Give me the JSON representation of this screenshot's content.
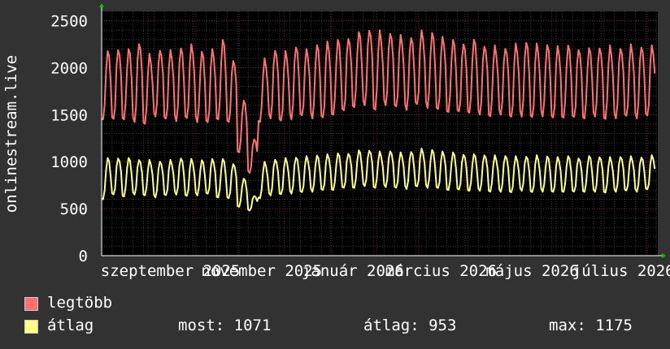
{
  "chart_data": {
    "type": "line",
    "ylabel": "onlinestream.live",
    "ylim": [
      0,
      2600
    ],
    "yticks": [
      0,
      500,
      1000,
      1500,
      2000,
      2500
    ],
    "x_tick_labels": [
      "szeptember 2025",
      "november 2025",
      "január 2026",
      "március 2026",
      "május 2026",
      "július 2026"
    ],
    "x_range": [
      "2025-08-01",
      "2026-08-08"
    ],
    "grid": true,
    "series": [
      {
        "name": "legtöbb",
        "color": "#ff7070",
        "weekly_high": [
          2180,
          2220,
          2200,
          2280,
          2150,
          2200,
          2190,
          2220,
          2250,
          2180,
          2200,
          2300,
          2100,
          1650,
          1250,
          2100,
          2200,
          2180,
          2230,
          2200,
          2250,
          2280,
          2300,
          2340,
          2380,
          2420,
          2400,
          2380,
          2350,
          2330,
          2400,
          2380,
          2330,
          2300,
          2280,
          2300,
          2250,
          2240,
          2220,
          2260,
          2280,
          2260,
          2250,
          2230,
          2240,
          2220,
          2210,
          2230,
          2240,
          2220,
          2250,
          2230,
          2240
        ],
        "weekly_low": [
          1450,
          1430,
          1450,
          1420,
          1400,
          1480,
          1450,
          1430,
          1450,
          1420,
          1400,
          1450,
          1400,
          1100,
          880,
          1420,
          1460,
          1430,
          1450,
          1480,
          1460,
          1450,
          1500,
          1520,
          1580,
          1600,
          1550,
          1600,
          1580,
          1550,
          1600,
          1570,
          1540,
          1530,
          1510,
          1520,
          1500,
          1480,
          1500,
          1470,
          1480,
          1460,
          1480,
          1450,
          1470,
          1450,
          1460,
          1480,
          1450,
          1460,
          1480,
          1460,
          1480
        ]
      },
      {
        "name": "átlag",
        "color": "#ffff80",
        "weekly_high": [
          1040,
          1050,
          1040,
          1030,
          1020,
          1010,
          1020,
          1040,
          1030,
          1020,
          1030,
          1030,
          990,
          820,
          640,
          1000,
          1030,
          1040,
          1050,
          1060,
          1070,
          1080,
          1090,
          1100,
          1120,
          1130,
          1110,
          1120,
          1100,
          1110,
          1140,
          1130,
          1110,
          1100,
          1090,
          1080,
          1080,
          1070,
          1070,
          1060,
          1060,
          1070,
          1060,
          1050,
          1060,
          1050,
          1060,
          1060,
          1050,
          1060,
          1060,
          1050,
          1070
        ],
        "weekly_low": [
          600,
          640,
          630,
          650,
          640,
          620,
          640,
          650,
          630,
          640,
          650,
          620,
          600,
          520,
          480,
          610,
          640,
          650,
          660,
          670,
          680,
          690,
          700,
          710,
          720,
          740,
          720,
          730,
          720,
          710,
          730,
          720,
          710,
          700,
          690,
          690,
          690,
          680,
          680,
          670,
          690,
          670,
          680,
          670,
          680,
          670,
          680,
          680,
          670,
          680,
          690,
          680,
          700
        ]
      }
    ]
  },
  "legend": [
    {
      "label": "legtöbb",
      "color": "#ff7070"
    },
    {
      "label": "átlag",
      "color": "#ffff80"
    }
  ],
  "stats": {
    "most": "most: 1071",
    "atlag": "átlag: 953",
    "max": "max: 1175"
  }
}
